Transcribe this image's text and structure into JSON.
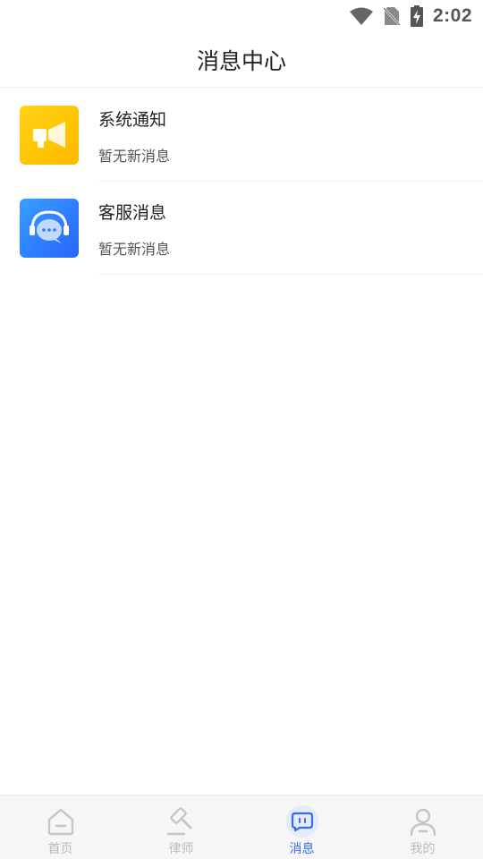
{
  "status_bar": {
    "time": "2:02",
    "icons": [
      "wifi-icon",
      "no-sim-icon",
      "battery-charging-icon"
    ]
  },
  "header": {
    "title": "消息中心"
  },
  "messages": [
    {
      "icon": "megaphone-icon",
      "title": "系统通知",
      "subtitle": "暂无新消息",
      "color": "#ffc400"
    },
    {
      "icon": "headset-chat-icon",
      "title": "客服消息",
      "subtitle": "暂无新消息",
      "color": "#2f7dff"
    }
  ],
  "tab_bar": {
    "tabs": [
      {
        "label": "首页",
        "icon": "home-icon",
        "active": false
      },
      {
        "label": "律师",
        "icon": "gavel-icon",
        "active": false
      },
      {
        "label": "消息",
        "icon": "message-icon",
        "active": true
      },
      {
        "label": "我的",
        "icon": "person-icon",
        "active": false
      }
    ],
    "active_color": "#3a6ee8",
    "inactive_color": "#bbbbbb"
  }
}
